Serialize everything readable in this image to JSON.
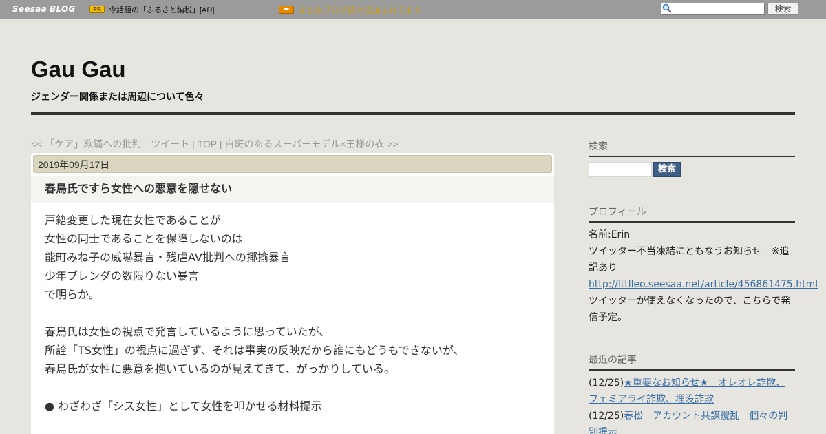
{
  "topbar": {
    "logo_main": "Seesaa",
    "logo_sub": "BLOG",
    "pr_label": "PR",
    "ad_text": "今話題の「ふるさと納税」[AD]",
    "notice_text": "まとめブログ続々追加されてます",
    "search_button": "検索",
    "search_value": ""
  },
  "header": {
    "title": "Gau Gau",
    "description": "ジェンダー関係または周辺について色々"
  },
  "nav": {
    "prev": "<< 「ケア」欺瞞への批判　ツイート",
    "sep1": " | ",
    "top": "TOP",
    "sep2": " | ",
    "next": "白斑のあるスーパーモデル×王様の衣 >>"
  },
  "article": {
    "date": "2019年09月17日",
    "title": "春鳥氏ですら女性への悪意を隠せない",
    "lines": [
      "戸籍変更した現在女性であることが",
      "女性の同士であることを保障しないのは",
      "能町みね子の威嚇暴言・残虐AV批判への揶揄暴言",
      "少年ブレンダの数限りない暴言",
      "で明らか。",
      "",
      "春鳥氏は女性の視点で発言しているように思っていたが、",
      "所詮「TS女性」の視点に過ぎず、それは事実の反映だから誰にもどうもできないが、",
      "春鳥氏が女性に悪意を抱いているのが見えてきて、がっかりしている。",
      "",
      "● わざわざ「シス女性」として女性を叩かせる材料提示"
    ]
  },
  "sidebar": {
    "search_heading": "検索",
    "search_button": "検索",
    "profile_heading": "プロフィール",
    "profile_name": "名前:Erin",
    "profile_notice": "ツイッター不当凍結にともなうお知らせ　※追記あり",
    "profile_link": "http://lttlleo.seesaa.net/article/456861475.html",
    "profile_note": "ツイッターが使えなくなったので、こちらで発信予定。",
    "recent_heading": "最近の記事",
    "recent": [
      {
        "date": "(12/25)",
        "title": "★重要なお知らせ★　オレオレ詐欺、フェミアライ詐欺、埋没詐欺"
      },
      {
        "date": "(12/25)",
        "title": "春松　アカウント共謀攪乱　個々の判別提示"
      }
    ]
  }
}
